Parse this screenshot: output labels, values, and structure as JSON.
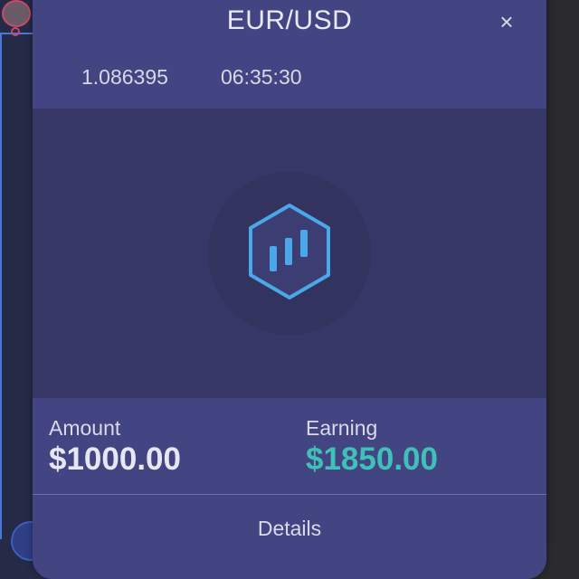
{
  "trade": {
    "pair": "EUR/USD",
    "rate": "1.086395",
    "time": "06:35:30",
    "close_symbol": "×"
  },
  "summary": {
    "amount_label": "Amount",
    "amount_value": "$1000.00",
    "earning_label": "Earning",
    "earning_value": "$1850.00"
  },
  "actions": {
    "details_label": "Details"
  },
  "icons": {
    "close": "close-icon",
    "logo": "hexagon-chart-icon"
  },
  "colors": {
    "modal_bg": "#424482",
    "body_bg": "#373767",
    "accent_blue": "#4aa8e8",
    "earning_green": "#3fc1b7",
    "text": "#e6e7f1"
  }
}
